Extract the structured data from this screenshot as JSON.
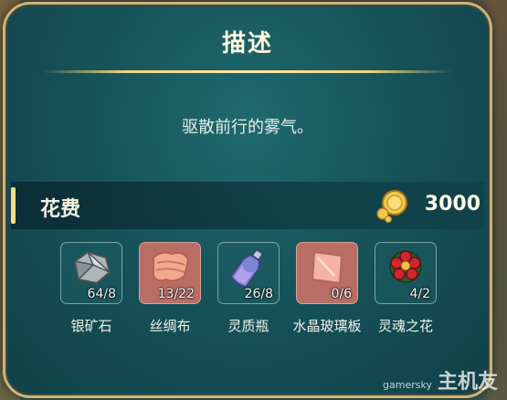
{
  "panel": {
    "title": "描述",
    "description": "驱散前行的雾气。"
  },
  "cost": {
    "label": "花费",
    "amount": "3000",
    "icon": "gold-coins-icon"
  },
  "materials": [
    {
      "name": "银矿石",
      "count": "64/8",
      "icon": "silver-ore-icon",
      "slot_color": "#1e5c62"
    },
    {
      "name": "丝绸布",
      "count": "13/22",
      "icon": "silk-cloth-icon",
      "slot_color": "#b96e65"
    },
    {
      "name": "灵质瓶",
      "count": "26/8",
      "icon": "spirit-bottle-icon",
      "slot_color": "#1e5c62"
    },
    {
      "name": "水晶玻璃板",
      "count": "0/6",
      "icon": "crystal-glass-icon",
      "slot_color": "#b96e65"
    },
    {
      "name": "灵魂之花",
      "count": "4/2",
      "icon": "soul-flower-icon",
      "slot_color": "#1e5c62"
    }
  ],
  "watermark": {
    "site": "gamersky",
    "brand": "主机友"
  }
}
